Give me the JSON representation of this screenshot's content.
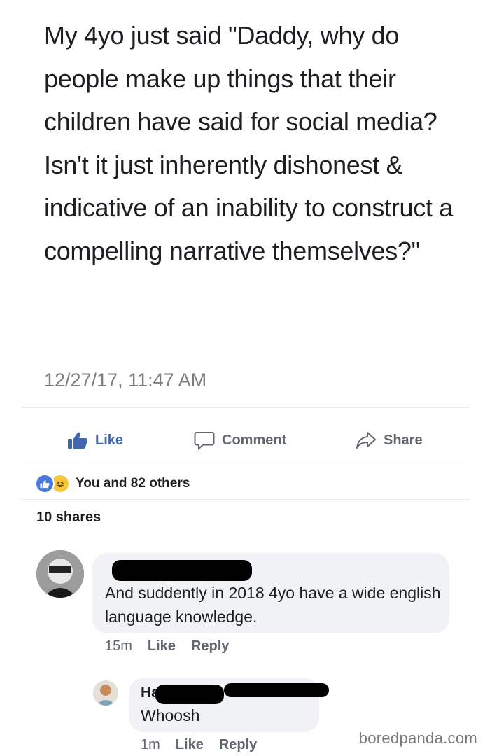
{
  "post": {
    "text": "My 4yo just said \"Daddy, why do  people make up things that their children have said for social media? Isn't it just inherently dishonest & indicative of an inability to construct a compelling narrative themselves?\"",
    "timestamp": "12/27/17, 11:47 AM"
  },
  "actions": {
    "like": "Like",
    "comment": "Comment",
    "share": "Share"
  },
  "reactions": {
    "summary": "You and 82 others",
    "icons": [
      "like-reaction-icon",
      "haha-reaction-icon"
    ]
  },
  "shares": "10 shares",
  "comments": [
    {
      "text": "And suddently in 2018 4yo have a wide english language knowledge.",
      "time": "15m",
      "like": "Like",
      "reply": "Reply"
    },
    {
      "author_fragment": "Ha",
      "text": "Whoosh",
      "time": "1m",
      "like": "Like",
      "reply": "Reply"
    }
  ],
  "watermark": "boredpanda.com",
  "colors": {
    "like_blue": "#4267b2",
    "action_gray": "#606770",
    "bubble_bg": "#f0f2f5",
    "text": "#1c1e21"
  }
}
